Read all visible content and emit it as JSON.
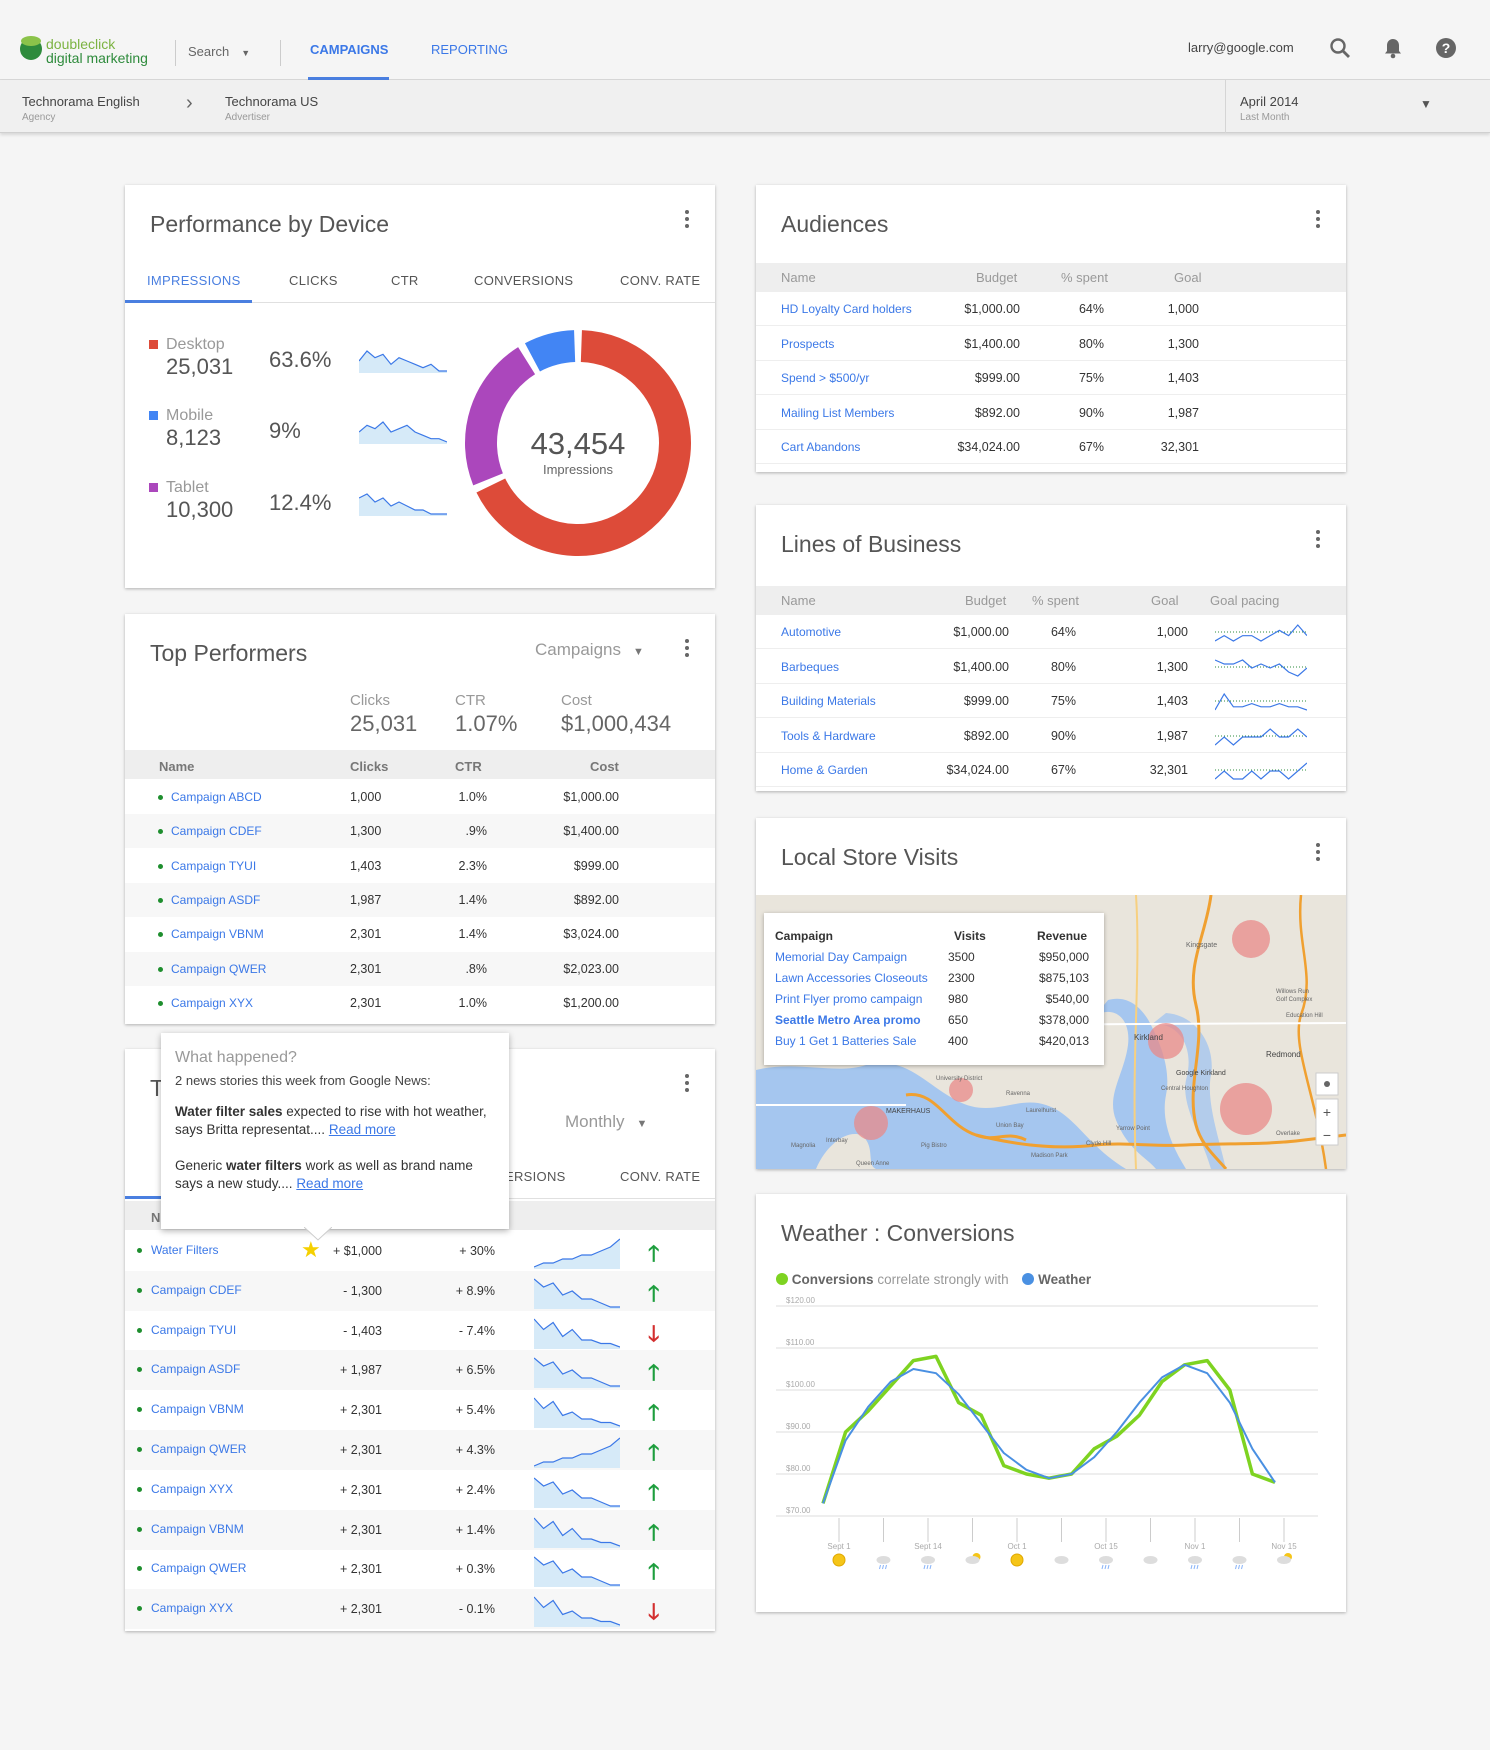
{
  "header": {
    "logo_line1": "doubleclick",
    "logo_line2": "digital marketing",
    "search_label": "Search",
    "tabs": [
      "CAMPAIGNS",
      "REPORTING"
    ],
    "user": "larry@google.com"
  },
  "breadcrumb": {
    "agency": "Technorama English",
    "agency_sub": "Agency",
    "advertiser": "Technorama US",
    "advertiser_sub": "Advertiser",
    "date": "April 2014",
    "date_sub": "Last Month"
  },
  "perf": {
    "title": "Performance by Device",
    "tabs": [
      "IMPRESSIONS",
      "CLICKS",
      "CTR",
      "CONVERSIONS",
      "CONV. RATE"
    ],
    "devices": [
      {
        "name": "Desktop",
        "value": "25,031",
        "pct": "63.6%",
        "color": "#dd4b39"
      },
      {
        "name": "Mobile",
        "value": "8,123",
        "pct": "9%",
        "color": "#4285f4"
      },
      {
        "name": "Tablet",
        "value": "10,300",
        "pct": "12.4%",
        "color": "#ab47bc"
      }
    ],
    "total": "43,454",
    "total_label": "Impressions"
  },
  "top": {
    "title": "Top Performers",
    "dropdown": "Campaigns",
    "summary": [
      {
        "label": "Clicks",
        "value": "25,031"
      },
      {
        "label": "CTR",
        "value": "1.07%"
      },
      {
        "label": "Cost",
        "value": "$1,000,434"
      }
    ],
    "cols": [
      "Name",
      "Clicks",
      "CTR",
      "Cost"
    ],
    "rows": [
      [
        "Campaign ABCD",
        "1,000",
        "1.0%",
        "$1,000.00"
      ],
      [
        "Campaign CDEF",
        "1,300",
        ".9%",
        "$1,400.00"
      ],
      [
        "Campaign TYUI",
        "1,403",
        "2.3%",
        "$999.00"
      ],
      [
        "Campaign ASDF",
        "1,987",
        "1.4%",
        "$892.00"
      ],
      [
        "Campaign VBNM",
        "2,301",
        "1.4%",
        "$3,024.00"
      ],
      [
        "Campaign QWER",
        "2,301",
        ".8%",
        "$2,023.00"
      ],
      [
        "Campaign XYX",
        "2,301",
        "1.0%",
        "$1,200.00"
      ]
    ]
  },
  "trend": {
    "title_initial": "T",
    "dropdown": "Monthly",
    "tab_partial": "ERSIONS",
    "tab_last": "CONV. RATE",
    "col_initial": "N",
    "rows": [
      {
        "name": "Water Filters",
        "a": "+ $1,000",
        "b": "+ 30%",
        "up": true,
        "star": true
      },
      {
        "name": "Campaign CDEF",
        "a": "- 1,300",
        "b": "+ 8.9%",
        "up": true
      },
      {
        "name": "Campaign TYUI",
        "a": "- 1,403",
        "b": "- 7.4%",
        "up": false
      },
      {
        "name": "Campaign ASDF",
        "a": "+ 1,987",
        "b": "+ 6.5%",
        "up": true
      },
      {
        "name": "Campaign VBNM",
        "a": "+ 2,301",
        "b": "+ 5.4%",
        "up": true
      },
      {
        "name": "Campaign QWER",
        "a": "+ 2,301",
        "b": "+ 4.3%",
        "up": true
      },
      {
        "name": "Campaign XYX",
        "a": "+ 2,301",
        "b": "+ 2.4%",
        "up": true
      },
      {
        "name": "Campaign VBNM",
        "a": "+ 2,301",
        "b": "+ 1.4%",
        "up": true
      },
      {
        "name": "Campaign QWER",
        "a": "+ 2,301",
        "b": "+ 0.3%",
        "up": true
      },
      {
        "name": "Campaign XYX",
        "a": "+ 2,301",
        "b": "- 0.1%",
        "up": false
      }
    ]
  },
  "popup": {
    "title": "What happened?",
    "sub": "2 news stories this week from Google News:",
    "s1_bold": "Water filter sales",
    "s1_text": " expected to rise with hot weather, says Britta representat.... ",
    "s2_pre": "Generic ",
    "s2_bold": "water filters",
    "s2_text": " work as well as brand name says a new study.... ",
    "read_more": "Read more"
  },
  "audiences": {
    "title": "Audiences",
    "cols": [
      "Name",
      "Budget",
      "% spent",
      "Goal"
    ],
    "rows": [
      [
        "HD Loyalty Card holders",
        "$1,000.00",
        "64%",
        "1,000"
      ],
      [
        "Prospects",
        "$1,400.00",
        "80%",
        "1,300"
      ],
      [
        "Spend > $500/yr",
        "$999.00",
        "75%",
        "1,403"
      ],
      [
        "Mailing List Members",
        "$892.00",
        "90%",
        "1,987"
      ],
      [
        "Cart Abandons",
        "$34,024.00",
        "67%",
        "32,301"
      ]
    ]
  },
  "lob": {
    "title": "Lines of Business",
    "cols": [
      "Name",
      "Budget",
      "% spent",
      "Goal",
      "Goal pacing"
    ],
    "rows": [
      [
        "Automotive",
        "$1,000.00",
        "64%",
        "1,000"
      ],
      [
        "Barbeques",
        "$1,400.00",
        "80%",
        "1,300"
      ],
      [
        "Building Materials",
        "$999.00",
        "75%",
        "1,403"
      ],
      [
        "Tools & Hardware",
        "$892.00",
        "90%",
        "1,987"
      ],
      [
        "Home & Garden",
        "$34,024.00",
        "67%",
        "32,301"
      ]
    ]
  },
  "local": {
    "title": "Local Store Visits",
    "cols": [
      "Campaign",
      "Visits",
      "Revenue"
    ],
    "rows": [
      [
        "Memorial Day Campaign",
        "3500",
        "$950,000"
      ],
      [
        "Lawn Accessories Closeouts",
        "2300",
        "$875,103"
      ],
      [
        "Print Flyer promo campaign",
        "980",
        "$540,00"
      ],
      [
        "Seattle Metro Area promo",
        "650",
        "$378,000"
      ],
      [
        "Buy 1 Get 1 Batteries Sale",
        "400",
        "$420,013"
      ]
    ],
    "map_labels": [
      "Kirkland",
      "Redmond",
      "MAKERHAUS",
      "Google Kirkland",
      "Kingsgate",
      "Willows Run Golf Complex",
      "Education Hill",
      "Central Houghton",
      "Union Bay",
      "Pig Bistro",
      "Magnolia",
      "Interbay",
      "Madison Park",
      "University District",
      "Yarrow Point",
      "Clyde Hill",
      "Overlake",
      "Queen Anne",
      "Ravenna",
      "Laurelhurst"
    ]
  },
  "weather": {
    "title": "Weather : Conversions",
    "legend_a": "Conversions",
    "legend_mid": "correlate strongly with",
    "legend_b": "Weather"
  },
  "chart_data": {
    "type": "line",
    "title": "Weather : Conversions",
    "y_ticks": [
      "$120.00",
      "$110.00",
      "$100.00",
      "$90.00",
      "$80.00",
      "$70.00"
    ],
    "ylim": [
      70,
      120
    ],
    "x_ticks": [
      "Sept 1",
      "Sept 14",
      "Oct 1",
      "Oct 15",
      "Nov 1",
      "Nov 15"
    ],
    "series": [
      {
        "name": "Conversions",
        "color": "#7ed321",
        "values": [
          73,
          90,
          95,
          101,
          107,
          108,
          97,
          94,
          82,
          80,
          79,
          80,
          86,
          89,
          94,
          102,
          106,
          107,
          100,
          80,
          78
        ]
      },
      {
        "name": "Weather",
        "color": "#4a90e2",
        "values": [
          73,
          88,
          96,
          102,
          105,
          104,
          99,
          92,
          85,
          81,
          79,
          80,
          84,
          90,
          97,
          103,
          106,
          104,
          97,
          86,
          78
        ]
      }
    ],
    "weather_icons": [
      "sun",
      "cloud-rain",
      "cloud-rain",
      "cloud-sun",
      "sun",
      "cloud",
      "cloud-rain",
      "cloud",
      "cloud-rain",
      "cloud-rain",
      "cloud-sun"
    ]
  }
}
